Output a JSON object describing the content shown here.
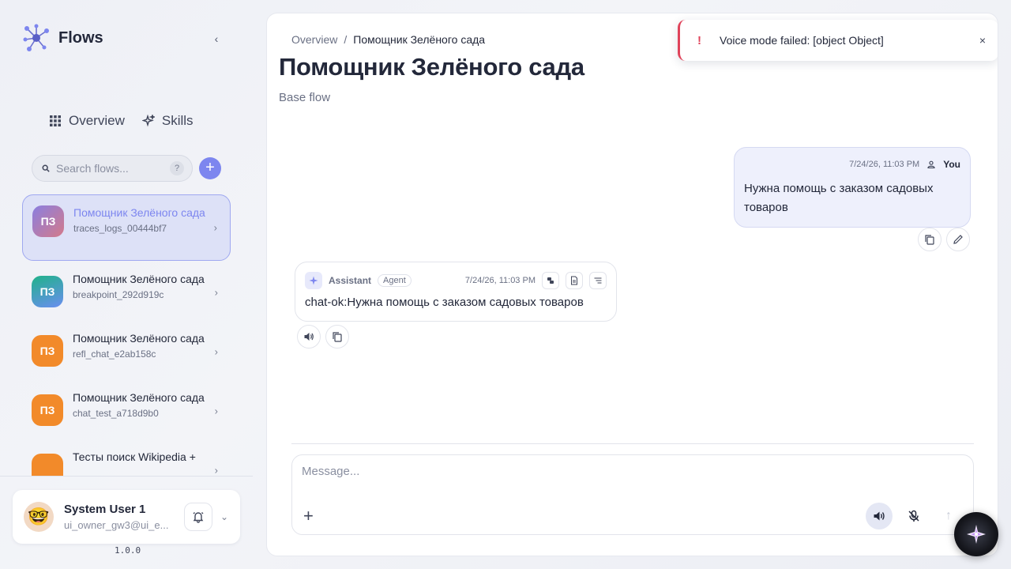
{
  "app": {
    "name": "Flows",
    "version": "1.0.0"
  },
  "nav": {
    "overview": "Overview",
    "skills": "Skills"
  },
  "search": {
    "placeholder": "Search flows...",
    "help": "?"
  },
  "add_label": "+",
  "flows": [
    {
      "initials": "ПЗ",
      "title": "Помощник Зелёного сада",
      "sub": "traces_logs_00444bf7",
      "color": "#b08ac8",
      "active": true
    },
    {
      "initials": "ПЗ",
      "title": "Помощник Зелёного сада",
      "sub": "breakpoint_292d919c",
      "color": "#30b4a0"
    },
    {
      "initials": "ПЗ",
      "title": "Помощник Зелёного сада",
      "sub": "refl_chat_e2ab158c",
      "color": "#f28a2a"
    },
    {
      "initials": "ПЗ",
      "title": "Помощник Зелёного сада",
      "sub": "chat_test_a718d9b0",
      "color": "#f28a2a"
    },
    {
      "initials": "",
      "title": "Тесты поиск Wikipedia +",
      "sub": "",
      "color": "#f28a2a"
    }
  ],
  "user": {
    "name": "System User 1",
    "email": "ui_owner_gw3@ui_e..."
  },
  "breadcrumb": {
    "root": "Overview",
    "sep": "/",
    "current": "Помощник Зелёного сада"
  },
  "page": {
    "title": "Помощник Зелёного сада",
    "subtitle": "Base flow"
  },
  "toast": {
    "icon": "!",
    "message": "Voice mode failed: [object Object]",
    "close": "×"
  },
  "messages": {
    "user": {
      "time": "7/24/26, 11:03 PM",
      "who": "You",
      "text": "Нужна помощь с заказом садовых товаров"
    },
    "assistant": {
      "name": "Assistant",
      "badge": "Agent",
      "time": "7/24/26, 11:03 PM",
      "text": "chat-ok:Нужна помощь с заказом садовых товаров"
    }
  },
  "composer": {
    "placeholder": "Message...",
    "attach": "+",
    "send": "↑"
  },
  "colors": {
    "accent": "#7d86ef",
    "error": "#e0435a"
  }
}
